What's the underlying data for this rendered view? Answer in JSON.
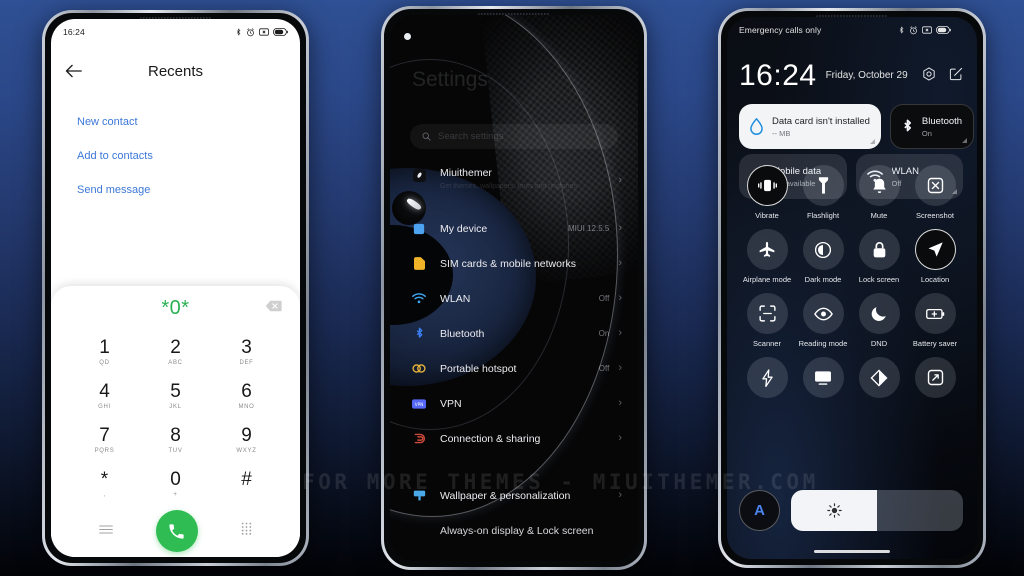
{
  "background": {
    "top_color": "#2f5094",
    "bottom_color": "#020307"
  },
  "watermark": {
    "text": "VISIT FOR MORE THEMES - MIUITHEMER.COM"
  },
  "phone1": {
    "statusbar": {
      "time": "16:24",
      "icons": [
        "bluetooth-icon",
        "alarm-icon",
        "vibrate-icon",
        "battery-icon"
      ]
    },
    "header": {
      "title": "Recents",
      "back_icon": "back-arrow-icon"
    },
    "links": [
      "New contact",
      "Add to contacts",
      "Send message"
    ],
    "dialer": {
      "number": "*0*",
      "backspace_icon": "backspace-icon",
      "keys": [
        {
          "digit": "1",
          "sub": "QD"
        },
        {
          "digit": "2",
          "sub": "ABC"
        },
        {
          "digit": "3",
          "sub": "DEF"
        },
        {
          "digit": "4",
          "sub": "GHI"
        },
        {
          "digit": "5",
          "sub": "JKL"
        },
        {
          "digit": "6",
          "sub": "MNO"
        },
        {
          "digit": "7",
          "sub": "PQRS"
        },
        {
          "digit": "8",
          "sub": "TUV"
        },
        {
          "digit": "9",
          "sub": "WXYZ"
        },
        {
          "digit": "*",
          "sub": ","
        },
        {
          "digit": "0",
          "sub": "+"
        },
        {
          "digit": "#",
          "sub": ""
        }
      ],
      "bottom": {
        "menu_icon": "menu-icon",
        "call_icon": "call-icon",
        "keypad_icon": "keypad-icon"
      },
      "call_button_color": "#2fbd53",
      "number_color": "#2bb153"
    }
  },
  "phone2": {
    "page_title": "Settings",
    "search": {
      "placeholder": "Search settings",
      "icon": "search-icon"
    },
    "rows": [
      {
        "label": "Miuithemer",
        "sub": "Get themes, wallpapers, fonts and ringtones",
        "value": "",
        "icon": "themes-icon",
        "icon_color": "#101114"
      },
      {
        "label": "My device",
        "sub": "",
        "value": "MIUI 12.5.5",
        "icon": "device-icon",
        "icon_color": "#4da3f0"
      },
      {
        "label": "SIM cards & mobile networks",
        "sub": "",
        "value": "",
        "icon": "sim-icon",
        "icon_color": "#f0b429"
      },
      {
        "label": "WLAN",
        "sub": "",
        "value": "Off",
        "icon": "wifi-icon",
        "icon_color": "#3ea8f5"
      },
      {
        "label": "Bluetooth",
        "sub": "",
        "value": "On",
        "icon": "bluetooth-icon",
        "icon_color": "#3b7ef0"
      },
      {
        "label": "Portable hotspot",
        "sub": "",
        "value": "Off",
        "icon": "hotspot-icon",
        "icon_color": "#e8b33a"
      },
      {
        "label": "VPN",
        "sub": "",
        "value": "",
        "icon": "vpn-icon",
        "icon_color": "#5567f5"
      },
      {
        "label": "Connection & sharing",
        "sub": "",
        "value": "",
        "icon": "connection-icon",
        "icon_color": "#d04a3a"
      },
      {
        "label": "Wallpaper & personalization",
        "sub": "",
        "value": "",
        "icon": "wallpaper-icon",
        "icon_color": "#4aa8e8"
      },
      {
        "label": "Always-on display & Lock screen",
        "sub": "",
        "value": "",
        "icon": "lockscreen-icon",
        "icon_color": "#6fb8f0"
      }
    ]
  },
  "phone3": {
    "statusbar": {
      "carrier": "Emergency calls only",
      "icons": [
        "bluetooth-icon",
        "alarm-icon",
        "vibrate-icon",
        "battery-icon"
      ]
    },
    "clock": {
      "time": "16:24",
      "date": "Friday, October 29"
    },
    "header_icons": [
      "settings-gear-icon",
      "edit-icon"
    ],
    "big_tiles": [
      {
        "name": "Data card isn't installed",
        "state": "-- MB",
        "icon": "data-usage-icon",
        "style": "on"
      },
      {
        "name": "Bluetooth",
        "state": "On",
        "icon": "bluetooth-icon",
        "style": "dark"
      },
      {
        "name": "Mobile data",
        "state": "Not available",
        "icon": "mobile-data-icon",
        "style": "off"
      },
      {
        "name": "WLAN",
        "state": "Off",
        "icon": "wifi-icon",
        "style": "off"
      }
    ],
    "toggles": [
      {
        "label": "Vibrate",
        "icon": "vibrate-icon",
        "active": true
      },
      {
        "label": "Flashlight",
        "icon": "flashlight-icon",
        "active": false
      },
      {
        "label": "Mute",
        "icon": "bell-icon",
        "active": false
      },
      {
        "label": "Screenshot",
        "icon": "screenshot-icon",
        "active": false
      },
      {
        "label": "Airplane mode",
        "icon": "airplane-icon",
        "active": false
      },
      {
        "label": "Dark mode",
        "icon": "dark-mode-icon",
        "active": false
      },
      {
        "label": "Lock screen",
        "icon": "lock-icon",
        "active": false
      },
      {
        "label": "Location",
        "icon": "location-icon",
        "active": true
      },
      {
        "label": "Scanner",
        "icon": "scanner-icon",
        "active": false
      },
      {
        "label": "Reading mode",
        "icon": "eye-icon",
        "active": false
      },
      {
        "label": "DND",
        "icon": "moon-icon",
        "active": false
      },
      {
        "label": "Battery saver",
        "icon": "battery-saver-icon",
        "active": false
      },
      {
        "label": "",
        "icon": "lightning-icon",
        "active": false
      },
      {
        "label": "",
        "icon": "cast-icon",
        "active": false
      },
      {
        "label": "",
        "icon": "theme-icon",
        "active": false
      },
      {
        "label": "",
        "icon": "expand-icon",
        "active": false
      }
    ],
    "brightness": {
      "auto_label": "A",
      "level_percent": 50,
      "icon": "brightness-icon"
    }
  }
}
